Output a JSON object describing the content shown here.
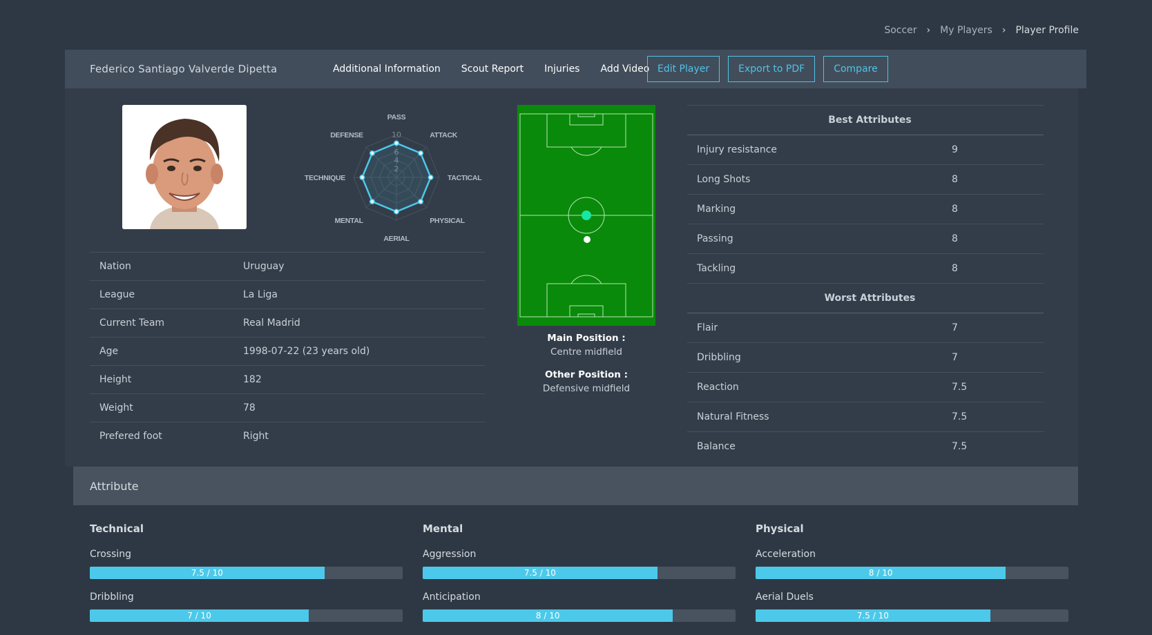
{
  "breadcrumb": {
    "items": [
      "Soccer",
      "My Players"
    ],
    "current": "Player Profile"
  },
  "header": {
    "player_name": "Federico Santiago Valverde Dipetta",
    "nav": [
      "Additional Information",
      "Scout Report",
      "Injuries",
      "Add Video"
    ],
    "buttons": [
      "Edit Player",
      "Export to PDF",
      "Compare"
    ]
  },
  "radar": {
    "axes": [
      "PASS",
      "ATTACK",
      "TACTICAL",
      "PHYSICAL",
      "AERIAL",
      "MENTAL",
      "TECHNIQUE",
      "DEFENSE"
    ],
    "ticks": [
      "2",
      "4",
      "6",
      "8",
      "10"
    ],
    "values": [
      8,
      8,
      8,
      8,
      8,
      8,
      8,
      8
    ],
    "max": 10,
    "color": "#4cc9ea"
  },
  "info": [
    {
      "label": "Nation",
      "value": "Uruguay"
    },
    {
      "label": "League",
      "value": "La Liga"
    },
    {
      "label": "Current Team",
      "value": "Real Madrid"
    },
    {
      "label": "Age",
      "value": "1998-07-22 (23 years old)"
    },
    {
      "label": "Height",
      "value": "182"
    },
    {
      "label": "Weight",
      "value": "78"
    },
    {
      "label": "Prefered foot",
      "value": "Right"
    }
  ],
  "positions": {
    "main_title": "Main Position :",
    "main_value": "Centre midfield",
    "other_title": "Other Position :",
    "other_value": "Defensive midfield"
  },
  "best_title": "Best Attributes",
  "best": [
    {
      "name": "Injury resistance",
      "value": "9"
    },
    {
      "name": "Long Shots",
      "value": "8"
    },
    {
      "name": "Marking",
      "value": "8"
    },
    {
      "name": "Passing",
      "value": "8"
    },
    {
      "name": "Tackling",
      "value": "8"
    }
  ],
  "worst_title": "Worst Attributes",
  "worst": [
    {
      "name": "Flair",
      "value": "7"
    },
    {
      "name": "Dribbling",
      "value": "7"
    },
    {
      "name": "Reaction",
      "value": "7.5"
    },
    {
      "name": "Natural Fitness",
      "value": "7.5"
    },
    {
      "name": "Balance",
      "value": "7.5"
    }
  ],
  "attribute_section": {
    "title": "Attribute",
    "columns": [
      {
        "title": "Technical",
        "items": [
          {
            "name": "Crossing",
            "text": "7.5 / 10",
            "value": 7.5
          },
          {
            "name": "Dribbling",
            "text": "7 / 10",
            "value": 7
          }
        ]
      },
      {
        "title": "Mental",
        "items": [
          {
            "name": "Aggression",
            "text": "7.5 / 10",
            "value": 7.5
          },
          {
            "name": "Anticipation",
            "text": "8 / 10",
            "value": 8
          }
        ]
      },
      {
        "title": "Physical",
        "items": [
          {
            "name": "Acceleration",
            "text": "8 / 10",
            "value": 8
          },
          {
            "name": "Aerial Duels",
            "text": "7.5 / 10",
            "value": 7.5
          }
        ]
      }
    ]
  },
  "colors": {
    "accent": "#4cc9ea",
    "pitch": "#0a8a0a",
    "main_pos_marker": "#19e6a4"
  }
}
